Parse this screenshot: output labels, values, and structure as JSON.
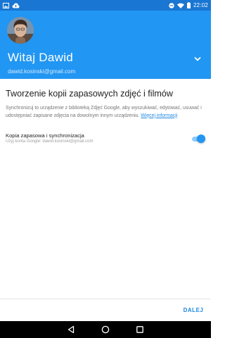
{
  "status_bar": {
    "time": "22:02",
    "icons_left": [
      "image-icon",
      "cloud-upload-icon"
    ],
    "icons_right": [
      "do-not-disturb-icon",
      "wifi-icon",
      "battery-icon"
    ]
  },
  "header": {
    "greeting": "Witaj Dawid",
    "email": "dawid.kosinski@gmail.com",
    "account_switcher_icon": "chevron-down-icon"
  },
  "main": {
    "title": "Tworzenie kopii zapasowych zdjęć i filmów",
    "description": "Synchronizuj to urządzenie z biblioteką Zdjęć Google, aby wyszukiwać, edytować, usuwać i udostępniać zapisane zdjęcia na dowolnym innym urządzeniu.",
    "more_link": "Więcej informacji"
  },
  "setting": {
    "title": "Kopia zapasowa i synchronizacja",
    "subtitle": "Użyj konta Google: dawid.kosinski@gmail.com",
    "enabled": true
  },
  "footer": {
    "next_label": "DALEJ"
  },
  "nav": {
    "icons": [
      "back-icon",
      "home-icon",
      "recents-icon"
    ]
  },
  "colors": {
    "status_bar": "#1976d2",
    "header": "#2196f3",
    "accent": "#1e88e5"
  }
}
